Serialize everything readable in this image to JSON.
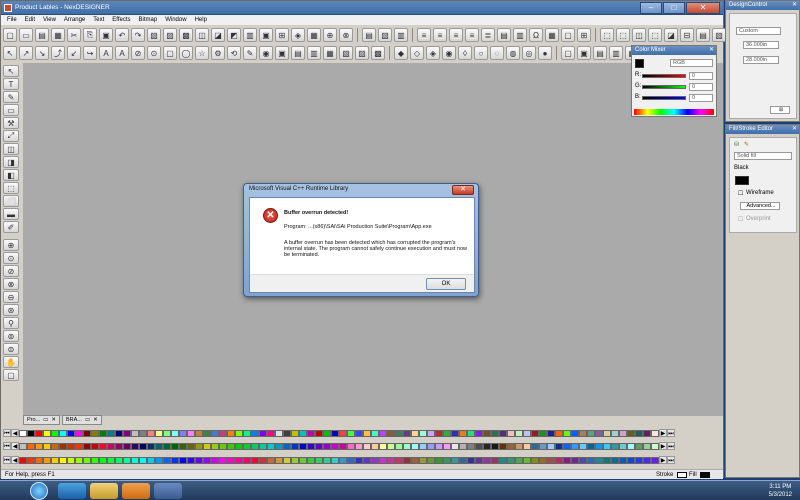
{
  "app": {
    "title": "Product Lables - NexDESIGNER",
    "menu": [
      "File",
      "Edit",
      "View",
      "Arrange",
      "Text",
      "Effects",
      "Bitmap",
      "Window",
      "Help"
    ],
    "doc_tabs": [
      "Pro...",
      "BRA..."
    ],
    "status": "For Help, press F1",
    "stroke_label": "Stroke",
    "fill_label": "Fill"
  },
  "color_mixer": {
    "title": "Color Mixer",
    "mode": "RGB",
    "channels": [
      {
        "label": "R:",
        "value": "0"
      },
      {
        "label": "G:",
        "value": "0"
      },
      {
        "label": "B:",
        "value": "0"
      }
    ]
  },
  "design_control": {
    "title": "DesignControl",
    "preset": "Custom",
    "width": "36.000in",
    "height": "28.000in"
  },
  "fill_stroke": {
    "title": "Fill/Stroke Editor",
    "fill_type": "Solid fill",
    "color_name": "Black",
    "wireframe_label": "Wireframe",
    "advanced_label": "Advanced...",
    "overprint_label": "Overprint"
  },
  "dialog": {
    "title": "Microsoft Visual C++ Runtime Library",
    "heading": "Buffer overrun detected!",
    "program": "Program: ...(x86)\\SAi\\SAi Production Suite\\Program\\App.exe",
    "message": "A buffer overrun has been detected which has corrupted the program's internal state.  The program cannot safely continue execution and must now be terminated.",
    "ok_label": "OK"
  },
  "taskbar": {
    "time": "3:11 PM",
    "date": "5/3/2012"
  },
  "palette_rows": [
    [
      "#ffffff",
      "#000000",
      "#ff0000",
      "#ffff00",
      "#00ff00",
      "#00ffff",
      "#0000ff",
      "#ff00ff",
      "#800000",
      "#808000",
      "#008000",
      "#008080",
      "#000080",
      "#800080",
      "#c0c0c0",
      "#808080",
      "#ff8080",
      "#ffff80",
      "#80ff80",
      "#80ffff",
      "#8080ff",
      "#ff80ff",
      "#c08040",
      "#408040",
      "#4080c0",
      "#c04080",
      "#ff8000",
      "#80ff00",
      "#00ff80",
      "#0080ff",
      "#8000ff",
      "#ff0080",
      "#e0e0e0",
      "#404040",
      "#c0c000",
      "#00c0c0",
      "#c000c0",
      "#c00000",
      "#00c000",
      "#0000c0",
      "#ff4040",
      "#40ff40",
      "#4040ff",
      "#ffc040",
      "#40ffc0",
      "#c040ff",
      "#806040",
      "#408060",
      "#604080",
      "#ffd0a0",
      "#a0ffd0",
      "#d0a0ff",
      "#b03030",
      "#30b030",
      "#3030b0",
      "#e08020",
      "#20e080",
      "#8020e0",
      "#705030",
      "#307050",
      "#503070",
      "#f0c0c0",
      "#c0f0c0",
      "#c0c0f0",
      "#902020",
      "#209020",
      "#202090",
      "#ff6000",
      "#60ff00",
      "#0060ff",
      "#a08060",
      "#60a080",
      "#8060a0",
      "#d0d0a0",
      "#a0d0d0",
      "#d0a0d0",
      "#606020",
      "#206060",
      "#602060",
      "#ffe0e0"
    ],
    [
      "#c0c0c0",
      "#ff6600",
      "#ff9900",
      "#ffcc00",
      "#cc6600",
      "#993300",
      "#cc3300",
      "#ff3300",
      "#990000",
      "#cc0000",
      "#ff0033",
      "#cc0066",
      "#990066",
      "#660066",
      "#330066",
      "#000066",
      "#003366",
      "#006666",
      "#006633",
      "#006600",
      "#336600",
      "#666600",
      "#999900",
      "#cccc00",
      "#99cc00",
      "#66cc00",
      "#33cc00",
      "#00cc00",
      "#00cc33",
      "#00cc66",
      "#00cc99",
      "#00cccc",
      "#0099cc",
      "#0066cc",
      "#0033cc",
      "#0000cc",
      "#3300cc",
      "#6600cc",
      "#9900cc",
      "#cc00cc",
      "#cc0099",
      "#ff66cc",
      "#ff99cc",
      "#ffcccc",
      "#ffcc99",
      "#ffff99",
      "#ccff99",
      "#99ff99",
      "#99ffcc",
      "#99ffff",
      "#99ccff",
      "#9999ff",
      "#cc99ff",
      "#ff99ff",
      "#e6e6e6",
      "#b3b3b3",
      "#808080",
      "#4d4d4d",
      "#262626",
      "#1a1a1a",
      "#663300",
      "#996633",
      "#cc9966",
      "#ffcc99",
      "#336699",
      "#6699cc",
      "#99ccff",
      "#003399",
      "#0066ff",
      "#3399ff",
      "#66ccff",
      "#006699",
      "#0099ff",
      "#33ccff",
      "#339999",
      "#66cccc",
      "#99ffff",
      "#669966",
      "#99cc99",
      "#ccffcc"
    ],
    [
      "#ff0000",
      "#ff3300",
      "#ff6600",
      "#ff9900",
      "#ffcc00",
      "#ffff00",
      "#ccff00",
      "#99ff00",
      "#66ff00",
      "#33ff00",
      "#00ff00",
      "#00ff33",
      "#00ff66",
      "#00ff99",
      "#00ffcc",
      "#00ffff",
      "#00ccff",
      "#0099ff",
      "#0066ff",
      "#0033ff",
      "#0000ff",
      "#3300ff",
      "#6600ff",
      "#9900ff",
      "#cc00ff",
      "#ff00ff",
      "#ff00cc",
      "#ff0099",
      "#ff0066",
      "#ff0033",
      "#cc3333",
      "#cc6633",
      "#cc9933",
      "#cccc33",
      "#99cc33",
      "#66cc33",
      "#33cc33",
      "#33cc66",
      "#33cc99",
      "#33cccc",
      "#3399cc",
      "#3366cc",
      "#3333cc",
      "#6633cc",
      "#9933cc",
      "#cc33cc",
      "#cc3399",
      "#cc3366",
      "#993333",
      "#996633",
      "#999933",
      "#669933",
      "#339933",
      "#339966",
      "#339999",
      "#336699",
      "#333399",
      "#663399",
      "#993399",
      "#993366",
      "#1a8a8a",
      "#2a9a6a",
      "#4aaa4a",
      "#6aba2a",
      "#8a8a1a",
      "#9a6a2a",
      "#aa4a4a",
      "#ba2a6a",
      "#8a1a8a",
      "#6a2a9a",
      "#4a4aaa",
      "#2a6aba",
      "#1a8a9a",
      "#0d7a7a",
      "#0d6a9a",
      "#0d5aba",
      "#0d4ada",
      "#2d3aea",
      "#4d2afa",
      "#6d1aff"
    ]
  ]
}
